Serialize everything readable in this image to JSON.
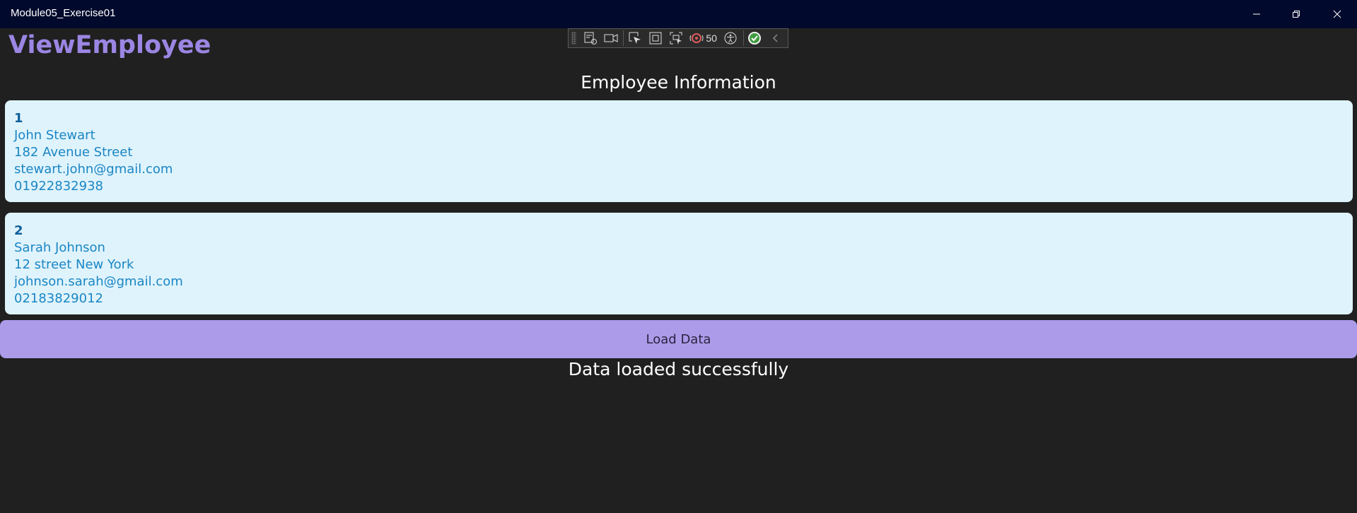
{
  "window": {
    "title": "Module05_Exercise01",
    "controls": [
      "minimize-icon",
      "restore-icon",
      "close-icon"
    ]
  },
  "page": {
    "title": "ViewEmployee",
    "heading": "Employee Information"
  },
  "debug_toolbar": {
    "icons": [
      "live-visual-tree-icon",
      "video-camera-icon",
      "select-element-icon",
      "display-layout-adorners-icon",
      "track-focus-icon",
      "hot-reload-icon",
      "accessibility-icon",
      "checkmark-icon",
      "chevron-left-icon"
    ],
    "count": "50"
  },
  "employees": [
    {
      "id": "1",
      "name": "John Stewart",
      "address": "182 Avenue Street",
      "email": "stewart.john@gmail.com",
      "phone": "01922832938"
    },
    {
      "id": "2",
      "name": "Sarah Johnson",
      "address": "12 street New York",
      "email": "johnson.sarah@gmail.com",
      "phone": "02183829012"
    }
  ],
  "actions": {
    "load_label": "Load Data"
  },
  "status": {
    "message": "Data loaded successfully"
  },
  "colors": {
    "titlebar": "#010a2c",
    "background": "#202020",
    "accent": "#9b86e3",
    "button": "#ab9be9",
    "card": "#dff3fc",
    "card_text": "#1a86c4"
  }
}
